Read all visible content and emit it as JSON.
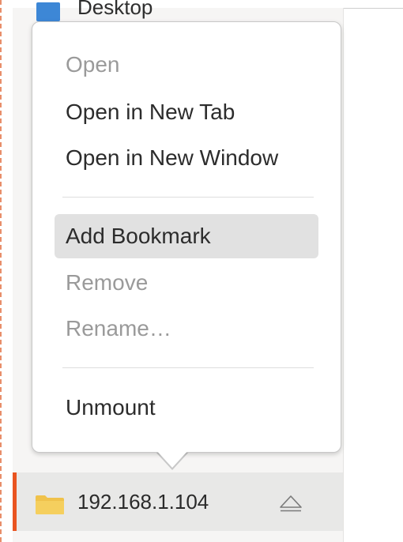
{
  "sidebar": {
    "top_item": {
      "label": "Desktop",
      "icon": "desktop-folder-icon"
    },
    "active_item": {
      "label": "192.168.1.104",
      "icon": "folder-icon",
      "eject_icon": "eject-icon"
    }
  },
  "context_menu": {
    "items": [
      {
        "label": "Open",
        "enabled": false
      },
      {
        "label": "Open in New Tab",
        "enabled": true
      },
      {
        "label": "Open in New Window",
        "enabled": true
      },
      {
        "label": "Add Bookmark",
        "enabled": true,
        "highlighted": true
      },
      {
        "label": "Remove",
        "enabled": false
      },
      {
        "label": "Rename…",
        "enabled": false
      },
      {
        "label": "Unmount",
        "enabled": true
      }
    ]
  },
  "colors": {
    "accent": "#e95420",
    "folder": "#f0c24b",
    "desktop_icon": "#3d87d6"
  }
}
